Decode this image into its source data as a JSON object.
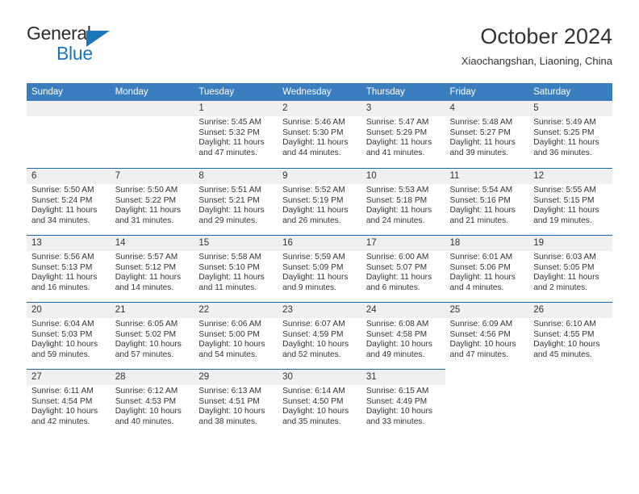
{
  "brand": {
    "line1": "General",
    "line2": "Blue",
    "triangle_color": "#1b75bb"
  },
  "header": {
    "month_title": "October 2024",
    "location": "Xiaochangshan, Liaoning, China"
  },
  "theme": {
    "header_bg": "#3a7ebf",
    "row_rule": "#1b6aa8",
    "daynum_bg": "#f0f0f0",
    "text": "#333333"
  },
  "weekday_headers": [
    "Sunday",
    "Monday",
    "Tuesday",
    "Wednesday",
    "Thursday",
    "Friday",
    "Saturday"
  ],
  "weeks": [
    [
      {
        "day": "",
        "sunrise": "",
        "sunset": "",
        "daylight1": "",
        "daylight2": "",
        "state": "empty"
      },
      {
        "day": "",
        "sunrise": "",
        "sunset": "",
        "daylight1": "",
        "daylight2": "",
        "state": "empty"
      },
      {
        "day": "1",
        "sunrise": "Sunrise: 5:45 AM",
        "sunset": "Sunset: 5:32 PM",
        "daylight1": "Daylight: 11 hours",
        "daylight2": "and 47 minutes.",
        "state": "filled"
      },
      {
        "day": "2",
        "sunrise": "Sunrise: 5:46 AM",
        "sunset": "Sunset: 5:30 PM",
        "daylight1": "Daylight: 11 hours",
        "daylight2": "and 44 minutes.",
        "state": "filled"
      },
      {
        "day": "3",
        "sunrise": "Sunrise: 5:47 AM",
        "sunset": "Sunset: 5:29 PM",
        "daylight1": "Daylight: 11 hours",
        "daylight2": "and 41 minutes.",
        "state": "filled"
      },
      {
        "day": "4",
        "sunrise": "Sunrise: 5:48 AM",
        "sunset": "Sunset: 5:27 PM",
        "daylight1": "Daylight: 11 hours",
        "daylight2": "and 39 minutes.",
        "state": "filled"
      },
      {
        "day": "5",
        "sunrise": "Sunrise: 5:49 AM",
        "sunset": "Sunset: 5:25 PM",
        "daylight1": "Daylight: 11 hours",
        "daylight2": "and 36 minutes.",
        "state": "filled"
      }
    ],
    [
      {
        "day": "6",
        "sunrise": "Sunrise: 5:50 AM",
        "sunset": "Sunset: 5:24 PM",
        "daylight1": "Daylight: 11 hours",
        "daylight2": "and 34 minutes.",
        "state": "filled"
      },
      {
        "day": "7",
        "sunrise": "Sunrise: 5:50 AM",
        "sunset": "Sunset: 5:22 PM",
        "daylight1": "Daylight: 11 hours",
        "daylight2": "and 31 minutes.",
        "state": "filled"
      },
      {
        "day": "8",
        "sunrise": "Sunrise: 5:51 AM",
        "sunset": "Sunset: 5:21 PM",
        "daylight1": "Daylight: 11 hours",
        "daylight2": "and 29 minutes.",
        "state": "filled"
      },
      {
        "day": "9",
        "sunrise": "Sunrise: 5:52 AM",
        "sunset": "Sunset: 5:19 PM",
        "daylight1": "Daylight: 11 hours",
        "daylight2": "and 26 minutes.",
        "state": "filled"
      },
      {
        "day": "10",
        "sunrise": "Sunrise: 5:53 AM",
        "sunset": "Sunset: 5:18 PM",
        "daylight1": "Daylight: 11 hours",
        "daylight2": "and 24 minutes.",
        "state": "filled"
      },
      {
        "day": "11",
        "sunrise": "Sunrise: 5:54 AM",
        "sunset": "Sunset: 5:16 PM",
        "daylight1": "Daylight: 11 hours",
        "daylight2": "and 21 minutes.",
        "state": "filled"
      },
      {
        "day": "12",
        "sunrise": "Sunrise: 5:55 AM",
        "sunset": "Sunset: 5:15 PM",
        "daylight1": "Daylight: 11 hours",
        "daylight2": "and 19 minutes.",
        "state": "filled"
      }
    ],
    [
      {
        "day": "13",
        "sunrise": "Sunrise: 5:56 AM",
        "sunset": "Sunset: 5:13 PM",
        "daylight1": "Daylight: 11 hours",
        "daylight2": "and 16 minutes.",
        "state": "filled"
      },
      {
        "day": "14",
        "sunrise": "Sunrise: 5:57 AM",
        "sunset": "Sunset: 5:12 PM",
        "daylight1": "Daylight: 11 hours",
        "daylight2": "and 14 minutes.",
        "state": "filled"
      },
      {
        "day": "15",
        "sunrise": "Sunrise: 5:58 AM",
        "sunset": "Sunset: 5:10 PM",
        "daylight1": "Daylight: 11 hours",
        "daylight2": "and 11 minutes.",
        "state": "filled"
      },
      {
        "day": "16",
        "sunrise": "Sunrise: 5:59 AM",
        "sunset": "Sunset: 5:09 PM",
        "daylight1": "Daylight: 11 hours",
        "daylight2": "and 9 minutes.",
        "state": "filled"
      },
      {
        "day": "17",
        "sunrise": "Sunrise: 6:00 AM",
        "sunset": "Sunset: 5:07 PM",
        "daylight1": "Daylight: 11 hours",
        "daylight2": "and 6 minutes.",
        "state": "filled"
      },
      {
        "day": "18",
        "sunrise": "Sunrise: 6:01 AM",
        "sunset": "Sunset: 5:06 PM",
        "daylight1": "Daylight: 11 hours",
        "daylight2": "and 4 minutes.",
        "state": "filled"
      },
      {
        "day": "19",
        "sunrise": "Sunrise: 6:03 AM",
        "sunset": "Sunset: 5:05 PM",
        "daylight1": "Daylight: 11 hours",
        "daylight2": "and 2 minutes.",
        "state": "filled"
      }
    ],
    [
      {
        "day": "20",
        "sunrise": "Sunrise: 6:04 AM",
        "sunset": "Sunset: 5:03 PM",
        "daylight1": "Daylight: 10 hours",
        "daylight2": "and 59 minutes.",
        "state": "filled"
      },
      {
        "day": "21",
        "sunrise": "Sunrise: 6:05 AM",
        "sunset": "Sunset: 5:02 PM",
        "daylight1": "Daylight: 10 hours",
        "daylight2": "and 57 minutes.",
        "state": "filled"
      },
      {
        "day": "22",
        "sunrise": "Sunrise: 6:06 AM",
        "sunset": "Sunset: 5:00 PM",
        "daylight1": "Daylight: 10 hours",
        "daylight2": "and 54 minutes.",
        "state": "filled"
      },
      {
        "day": "23",
        "sunrise": "Sunrise: 6:07 AM",
        "sunset": "Sunset: 4:59 PM",
        "daylight1": "Daylight: 10 hours",
        "daylight2": "and 52 minutes.",
        "state": "filled"
      },
      {
        "day": "24",
        "sunrise": "Sunrise: 6:08 AM",
        "sunset": "Sunset: 4:58 PM",
        "daylight1": "Daylight: 10 hours",
        "daylight2": "and 49 minutes.",
        "state": "filled"
      },
      {
        "day": "25",
        "sunrise": "Sunrise: 6:09 AM",
        "sunset": "Sunset: 4:56 PM",
        "daylight1": "Daylight: 10 hours",
        "daylight2": "and 47 minutes.",
        "state": "filled"
      },
      {
        "day": "26",
        "sunrise": "Sunrise: 6:10 AM",
        "sunset": "Sunset: 4:55 PM",
        "daylight1": "Daylight: 10 hours",
        "daylight2": "and 45 minutes.",
        "state": "filled"
      }
    ],
    [
      {
        "day": "27",
        "sunrise": "Sunrise: 6:11 AM",
        "sunset": "Sunset: 4:54 PM",
        "daylight1": "Daylight: 10 hours",
        "daylight2": "and 42 minutes.",
        "state": "filled"
      },
      {
        "day": "28",
        "sunrise": "Sunrise: 6:12 AM",
        "sunset": "Sunset: 4:53 PM",
        "daylight1": "Daylight: 10 hours",
        "daylight2": "and 40 minutes.",
        "state": "filled"
      },
      {
        "day": "29",
        "sunrise": "Sunrise: 6:13 AM",
        "sunset": "Sunset: 4:51 PM",
        "daylight1": "Daylight: 10 hours",
        "daylight2": "and 38 minutes.",
        "state": "filled"
      },
      {
        "day": "30",
        "sunrise": "Sunrise: 6:14 AM",
        "sunset": "Sunset: 4:50 PM",
        "daylight1": "Daylight: 10 hours",
        "daylight2": "and 35 minutes.",
        "state": "filled"
      },
      {
        "day": "31",
        "sunrise": "Sunrise: 6:15 AM",
        "sunset": "Sunset: 4:49 PM",
        "daylight1": "Daylight: 10 hours",
        "daylight2": "and 33 minutes.",
        "state": "filled"
      },
      {
        "day": "",
        "sunrise": "",
        "sunset": "",
        "daylight1": "",
        "daylight2": "",
        "state": "blank"
      },
      {
        "day": "",
        "sunrise": "",
        "sunset": "",
        "daylight1": "",
        "daylight2": "",
        "state": "blank"
      }
    ]
  ]
}
